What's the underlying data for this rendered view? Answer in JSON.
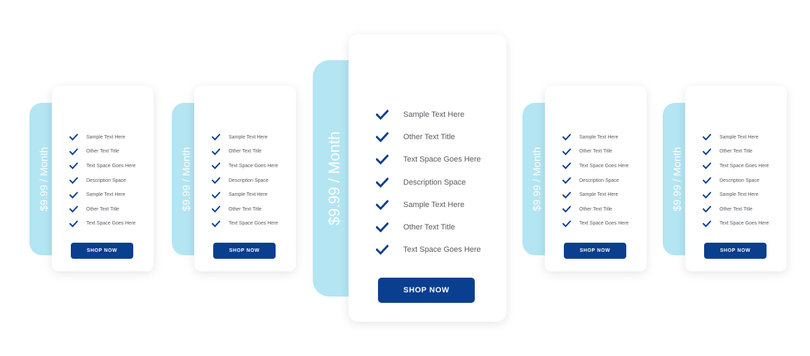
{
  "colors": {
    "accent": "#0a3f8f",
    "tab": "#b3e5f2",
    "card": "#ffffff",
    "text": "#555a60"
  },
  "plans": [
    {
      "price_label": "$9.99 / Month",
      "features": [
        {
          "icon": "check-icon",
          "label": "Sample Text Here"
        },
        {
          "icon": "check-icon",
          "label": "Other Text Title"
        },
        {
          "icon": "check-icon",
          "label": "Text Space Goes Here"
        },
        {
          "icon": "check-icon",
          "label": "Description Space"
        },
        {
          "icon": "check-icon",
          "label": "Sample Text Here"
        },
        {
          "icon": "check-icon",
          "label": "Other Text Title"
        },
        {
          "icon": "check-icon",
          "label": "Text Space Goes Here"
        }
      ],
      "button_label": "SHOP NOW"
    },
    {
      "price_label": "$9.99 / Month",
      "features": [
        {
          "icon": "check-icon",
          "label": "Sample Text Here"
        },
        {
          "icon": "check-icon",
          "label": "Other Text Title"
        },
        {
          "icon": "check-icon",
          "label": "Text Space Goes Here"
        },
        {
          "icon": "check-icon",
          "label": "Description Space"
        },
        {
          "icon": "check-icon",
          "label": "Sample Text Here"
        },
        {
          "icon": "check-icon",
          "label": "Other Text Title"
        },
        {
          "icon": "check-icon",
          "label": "Text Space Goes Here"
        }
      ],
      "button_label": "SHOP NOW"
    },
    {
      "price_label": "$9.99 / Month",
      "features": [
        {
          "icon": "check-icon",
          "label": "Sample Text Here"
        },
        {
          "icon": "check-icon",
          "label": "Other Text Title"
        },
        {
          "icon": "check-icon",
          "label": "Text Space Goes Here"
        },
        {
          "icon": "check-icon",
          "label": "Description Space"
        },
        {
          "icon": "check-icon",
          "label": "Sample Text Here"
        },
        {
          "icon": "check-icon",
          "label": "Other Text Title"
        },
        {
          "icon": "check-icon",
          "label": "Text Space Goes Here"
        }
      ],
      "button_label": "SHOP NOW"
    },
    {
      "price_label": "$9.99 / Month",
      "features": [
        {
          "icon": "check-icon",
          "label": "Sample Text Here"
        },
        {
          "icon": "check-icon",
          "label": "Other Text Title"
        },
        {
          "icon": "check-icon",
          "label": "Text Space Goes Here"
        },
        {
          "icon": "check-icon",
          "label": "Description Space"
        },
        {
          "icon": "check-icon",
          "label": "Sample Text Here"
        },
        {
          "icon": "check-icon",
          "label": "Other Text Title"
        },
        {
          "icon": "check-icon",
          "label": "Text Space Goes Here"
        }
      ],
      "button_label": "SHOP NOW"
    },
    {
      "price_label": "$9.99 / Month",
      "features": [
        {
          "icon": "check-icon",
          "label": "Sample Text Here"
        },
        {
          "icon": "check-icon",
          "label": "Other Text Title"
        },
        {
          "icon": "check-icon",
          "label": "Text Space Goes Here"
        },
        {
          "icon": "check-icon",
          "label": "Description Space"
        },
        {
          "icon": "check-icon",
          "label": "Sample Text Here"
        },
        {
          "icon": "check-icon",
          "label": "Other Text Title"
        },
        {
          "icon": "check-icon",
          "label": "Text Space Goes Here"
        }
      ],
      "button_label": "SHOP NOW"
    }
  ]
}
